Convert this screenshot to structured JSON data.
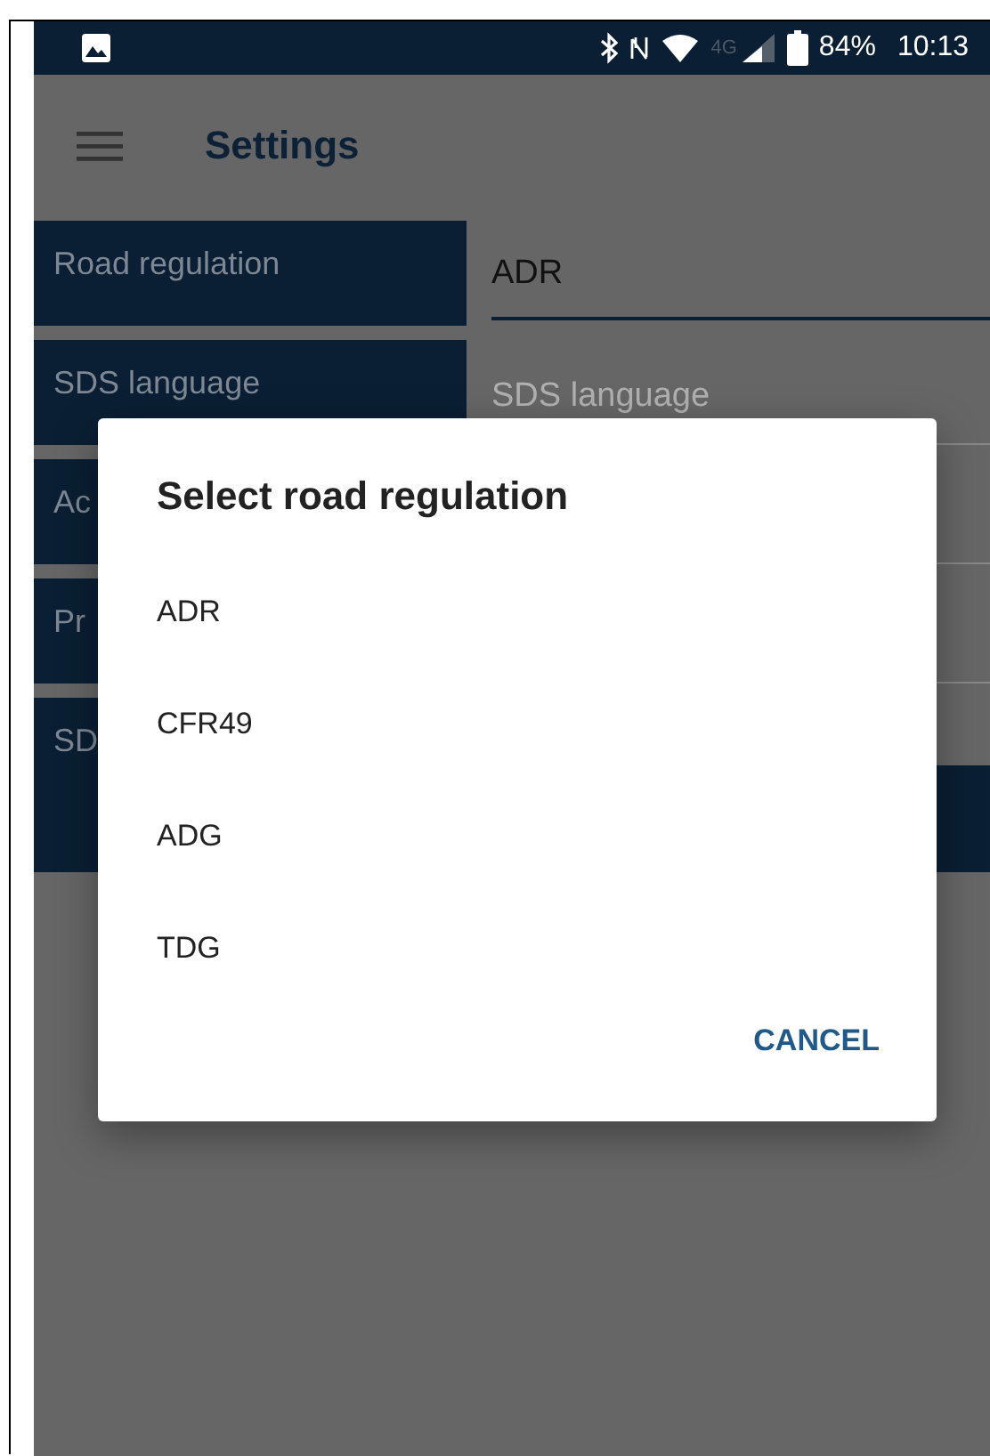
{
  "status_bar": {
    "network": "4G",
    "battery": "84%",
    "time": "10:13"
  },
  "app_bar": {
    "title": "Settings"
  },
  "settings": [
    {
      "label": "Road regulation",
      "value": "ADR"
    },
    {
      "label": "SDS language",
      "placeholder": "SDS language"
    },
    {
      "label": "Ac"
    },
    {
      "label": "Pr"
    },
    {
      "label": "SD"
    }
  ],
  "dialog": {
    "title": "Select road regulation",
    "options": [
      "ADR",
      "CFR49",
      "ADG",
      "TDG"
    ],
    "cancel": "CANCEL"
  }
}
